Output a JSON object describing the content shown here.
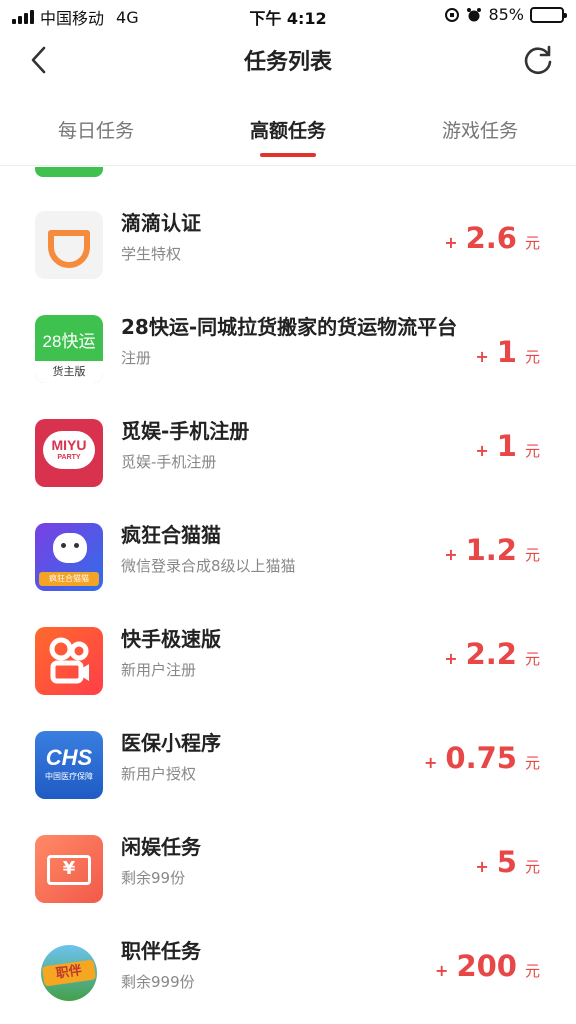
{
  "status_bar": {
    "carrier": "中国移动",
    "network": "4G",
    "time": "下午 4:12",
    "battery": "85%",
    "battery_level": 0.85
  },
  "header": {
    "title": "任务列表",
    "back_icon": "chevron-left-icon",
    "refresh_icon": "refresh-icon"
  },
  "tabs": [
    {
      "label": "每日任务",
      "active": false
    },
    {
      "label": "高额任务",
      "active": true
    },
    {
      "label": "游戏任务",
      "active": false
    }
  ],
  "tasks": [
    {
      "title": "滴滴认证",
      "subtitle": "学生特权",
      "plus": "+",
      "amount": "2.6",
      "unit": "元",
      "icon": "didi-icon"
    },
    {
      "title": "28快运-同城拉货搬家的货运物流平台",
      "subtitle": "注册",
      "plus": "+",
      "amount": "1",
      "unit": "元",
      "icon": "28kuaiyun-icon",
      "icon_text": "28快运",
      "icon_sub": "货主版"
    },
    {
      "title": "觅娱-手机注册",
      "subtitle": "觅娱-手机注册",
      "plus": "+",
      "amount": "1",
      "unit": "元",
      "icon": "miyu-party-icon",
      "icon_text": "MIYU",
      "icon_sub": "PARTY"
    },
    {
      "title": "疯狂合猫猫",
      "subtitle": "微信登录合成8级以上猫猫",
      "plus": "+",
      "amount": "1.2",
      "unit": "元",
      "icon": "crazy-cat-icon",
      "icon_sub": "疯狂合猫猫"
    },
    {
      "title": "快手极速版",
      "subtitle": "新用户注册",
      "plus": "+",
      "amount": "2.2",
      "unit": "元",
      "icon": "kuaishou-icon"
    },
    {
      "title": "医保小程序",
      "subtitle": "新用户授权",
      "plus": "+",
      "amount": "0.75",
      "unit": "元",
      "icon": "medical-insurance-icon",
      "icon_text": "CHS",
      "icon_sub": "中国医疗保障"
    },
    {
      "title": "闲娱任务",
      "subtitle": "剩余99份",
      "plus": "+",
      "amount": "5",
      "unit": "元",
      "icon": "ticket-icon",
      "icon_text": "¥"
    },
    {
      "title": "职伴任务",
      "subtitle": "剩余999份",
      "plus": "+",
      "amount": "200",
      "unit": "元",
      "icon": "zhiban-icon",
      "icon_text": "职伴"
    }
  ]
}
